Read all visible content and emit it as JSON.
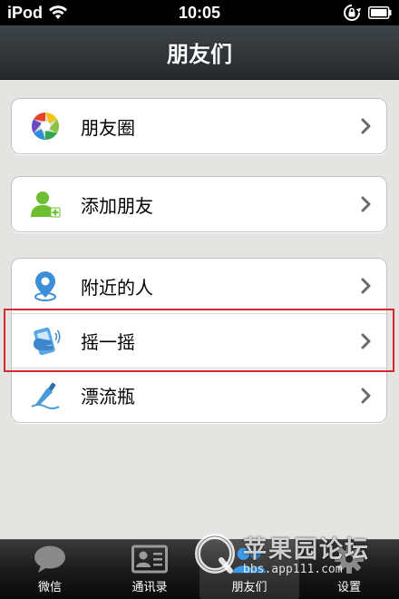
{
  "status_bar": {
    "carrier": "iPod",
    "time": "10:05"
  },
  "nav": {
    "title": "朋友们"
  },
  "groups": [
    {
      "items": [
        {
          "label": "朋友圈",
          "icon": "moments-aperture-icon"
        }
      ]
    },
    {
      "items": [
        {
          "label": "添加朋友",
          "icon": "add-friend-icon"
        }
      ]
    },
    {
      "items": [
        {
          "label": "附近的人",
          "icon": "location-pin-icon"
        },
        {
          "label": "摇一摇",
          "icon": "shake-phone-icon"
        },
        {
          "label": "漂流瓶",
          "icon": "drift-bottle-icon"
        }
      ]
    }
  ],
  "tab_bar": {
    "tabs": [
      {
        "label": "微信",
        "icon": "chat-bubble-icon",
        "active": false
      },
      {
        "label": "通讯录",
        "icon": "contacts-card-icon",
        "active": false
      },
      {
        "label": "朋友们",
        "icon": "friends-icon",
        "active": true
      },
      {
        "label": "设置",
        "icon": "settings-gear-icon",
        "active": false
      }
    ]
  },
  "watermark": {
    "title": "苹果园论坛",
    "url": "bbs.app111.com"
  },
  "colors": {
    "nav_bg": "#2f3437",
    "page_bg": "#e4e4e2",
    "highlight": "#d42a2f"
  }
}
